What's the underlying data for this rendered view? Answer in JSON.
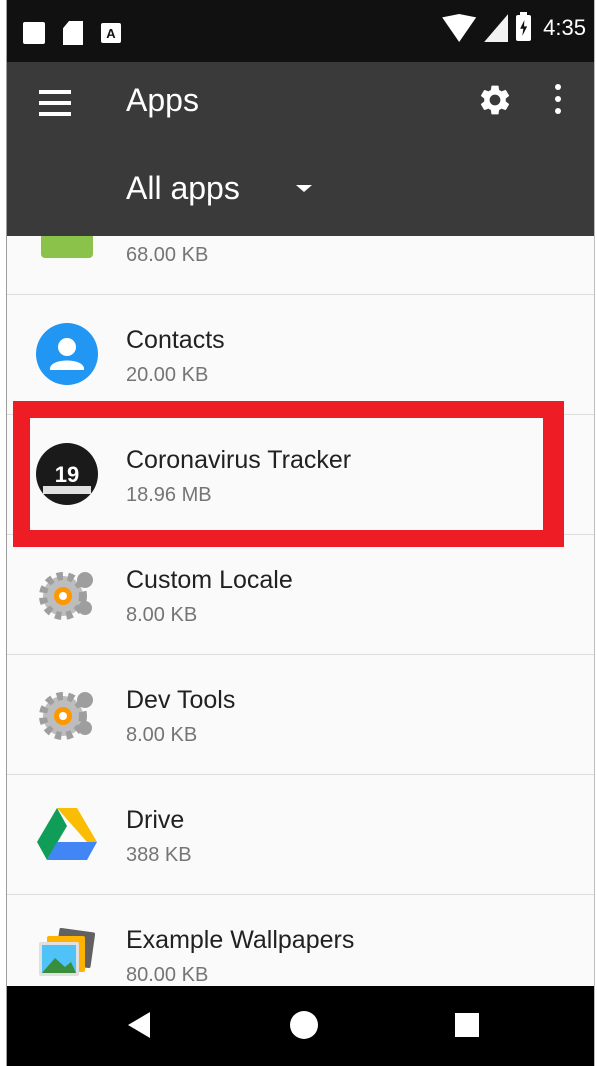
{
  "status_bar": {
    "time": "4:35",
    "notification_letter": "A",
    "icons": [
      "square-icon",
      "sd-card-icon",
      "a-icon",
      "wifi-icon",
      "signal-icon",
      "battery-charging-icon"
    ]
  },
  "app_bar": {
    "title": "Apps",
    "icons": [
      "menu-icon",
      "gear-icon",
      "more-vert-icon"
    ]
  },
  "filter": {
    "selected": "All apps",
    "icon": "dropdown-arrow-icon"
  },
  "apps": [
    {
      "name": "",
      "size": "68.00 KB",
      "icon": "green-app-icon"
    },
    {
      "name": "Contacts",
      "size": "20.00 KB",
      "icon": "contacts-icon"
    },
    {
      "name": "Coronavirus Tracker",
      "size": "18.96 MB",
      "icon": "covid19-tracker-icon",
      "icon_text": "19"
    },
    {
      "name": "Custom Locale",
      "size": "8.00 KB",
      "icon": "settings-gear-icon"
    },
    {
      "name": "Dev Tools",
      "size": "8.00 KB",
      "icon": "settings-gear-icon"
    },
    {
      "name": "Drive",
      "size": "388 KB",
      "icon": "drive-icon"
    },
    {
      "name": "Example Wallpapers",
      "size": "80.00 KB",
      "icon": "wallpapers-icon"
    }
  ],
  "highlight": {
    "target": "Coronavirus Tracker",
    "color": "#ee1c24"
  },
  "nav_bar": {
    "icons": [
      "back-icon",
      "home-icon",
      "recents-icon"
    ]
  },
  "colors": {
    "toolbar": "#3a3a3a",
    "status_bar": "#111111",
    "list_background": "#fafafa"
  }
}
